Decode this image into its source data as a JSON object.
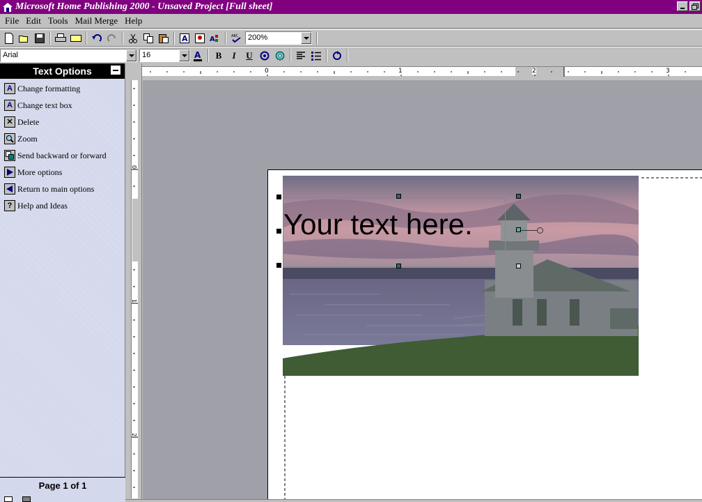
{
  "window": {
    "title": "Microsoft Home Publishing 2000 - Unsaved Project [Full sheet]"
  },
  "menubar": {
    "items": [
      "File",
      "Edit",
      "Tools",
      "Mail Merge",
      "Help"
    ]
  },
  "toolbar": {
    "zoom_value": "200%",
    "font_name": "Arial",
    "font_size": "16",
    "bold_label": "B",
    "italic_label": "I",
    "underline_label": "U"
  },
  "side_panel": {
    "title": "Text Options",
    "items": [
      {
        "label": "Change formatting",
        "icon": "letter-a-format-icon"
      },
      {
        "label": "Change text box",
        "icon": "text-box-icon"
      },
      {
        "label": "Delete",
        "icon": "delete-x-icon"
      },
      {
        "label": "Zoom",
        "icon": "magnifier-icon"
      },
      {
        "label": "Send backward or forward",
        "icon": "layers-icon"
      },
      {
        "label": "More options",
        "icon": "arrow-right-icon"
      },
      {
        "label": "Return to main options",
        "icon": "arrow-left-icon"
      },
      {
        "label": "Help and Ideas",
        "icon": "help-question-icon"
      }
    ],
    "page_label": "Page 1 of 1"
  },
  "rulers": {
    "horizontal_labels": [
      "0",
      "1",
      "2",
      "3"
    ],
    "vertical_labels": [
      "0",
      "1",
      "2"
    ]
  },
  "document": {
    "placeholder_text": "Your text here."
  },
  "colors": {
    "titlebar": "#800080",
    "panel_background": "#d4d8ec",
    "canvas_background": "#a0a0a8"
  }
}
